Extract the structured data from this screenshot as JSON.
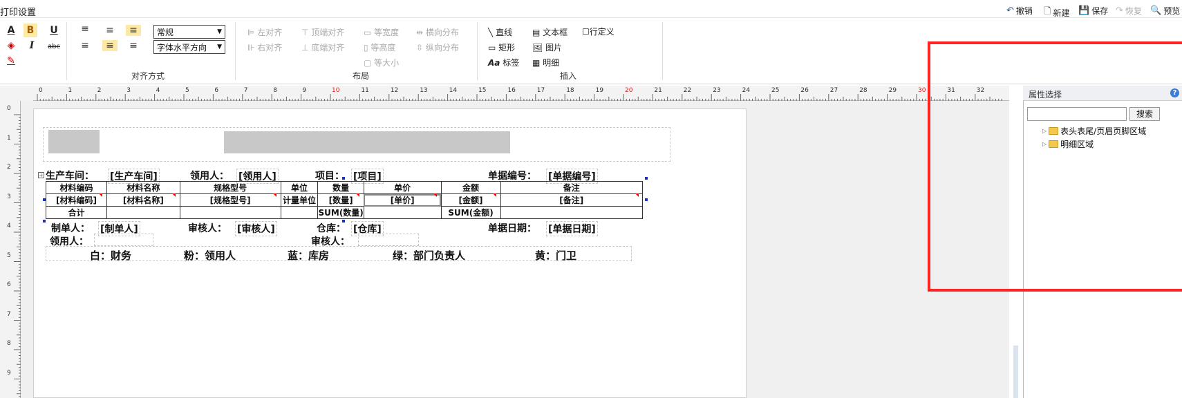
{
  "title_bar": {
    "app_title": "打印设置",
    "actions": {
      "undo": "撤销",
      "new": "新建",
      "save": "保存",
      "redo": "恢复",
      "preview": "预览"
    }
  },
  "ribbon": {
    "font": {
      "size_value": "常规",
      "h_align_value": "字体水平方向"
    },
    "align_group_label": "对齐方式",
    "layout": {
      "left_align": "左对齐",
      "right_align": "右对齐",
      "top_align": "顶端对齐",
      "bottom_align": "底端对齐",
      "equal_width": "等宽度",
      "equal_height": "等高度",
      "equal_size": "等大小",
      "h_distribute": "横向分布",
      "v_distribute": "纵向分布",
      "group_label": "布局"
    },
    "insert": {
      "line": "直线",
      "rect": "矩形",
      "label": "标签",
      "textbox": "文本框",
      "image": "图片",
      "detail": "明细",
      "custom_row": "行定义",
      "group_label": "插入"
    }
  },
  "ruler": {
    "top_ticks": [
      "0",
      "1",
      "2",
      "3",
      "4",
      "5",
      "6",
      "7",
      "8",
      "9",
      "10",
      "11",
      "12",
      "13",
      "14",
      "15",
      "16",
      "17",
      "18",
      "19",
      "20",
      "21",
      "22",
      "23",
      "24",
      "25",
      "26",
      "27",
      "28",
      "29",
      "30",
      "31",
      "32"
    ],
    "left_ticks": [
      "0",
      "1",
      "2",
      "3",
      "4",
      "5",
      "6",
      "7",
      "8",
      "9"
    ]
  },
  "report": {
    "fields_row1": {
      "workshop_label": "生产车间：",
      "workshop_value": "[生产车间]",
      "user_label": "领用人：",
      "user_value": "[领用人]",
      "project_label": "项目：",
      "project_value": "[项目]",
      "doc_no_label": "单据编号：",
      "doc_no_value": "[单据编号]"
    },
    "table_headers": [
      "材料编码",
      "材料名称",
      "规格型号",
      "单位",
      "数量",
      "单价",
      "金额",
      "备注"
    ],
    "table_fields": [
      "[材料编码]",
      "[材料名称]",
      "[规格型号]",
      "计量单位",
      "[数量]",
      "[单价]",
      "[金额]",
      "[备注]"
    ],
    "total_row": {
      "label": "合计",
      "qty_sum": "SUM(数量)",
      "amount_sum": "SUM(金额)"
    },
    "footer": {
      "maker_label": "制单人：",
      "maker_value": "[制单人]",
      "reviewer_label": "审核人：",
      "reviewer_value": "[审核人]",
      "warehouse_label": "仓库：",
      "warehouse_value": "[仓库]",
      "doc_date_label": "单据日期：",
      "doc_date_value": "[单据日期]",
      "user2_label": "领用人：",
      "reviewer2_label": "审核人："
    },
    "copies_line": {
      "white": "白：财务",
      "pink": "粉：领用人",
      "blue": "蓝：库房",
      "green": "绿：部门负责人",
      "yellow": "黄：门卫"
    }
  },
  "property_panel": {
    "title": "属性选择",
    "search_button": "搜索",
    "tree": [
      "表头表尾/页眉页脚区域",
      "明细区域"
    ]
  },
  "colors": {
    "highlight_box": "#ff2323",
    "handle": "#1a2fc4",
    "folder": "#f2c94c"
  }
}
